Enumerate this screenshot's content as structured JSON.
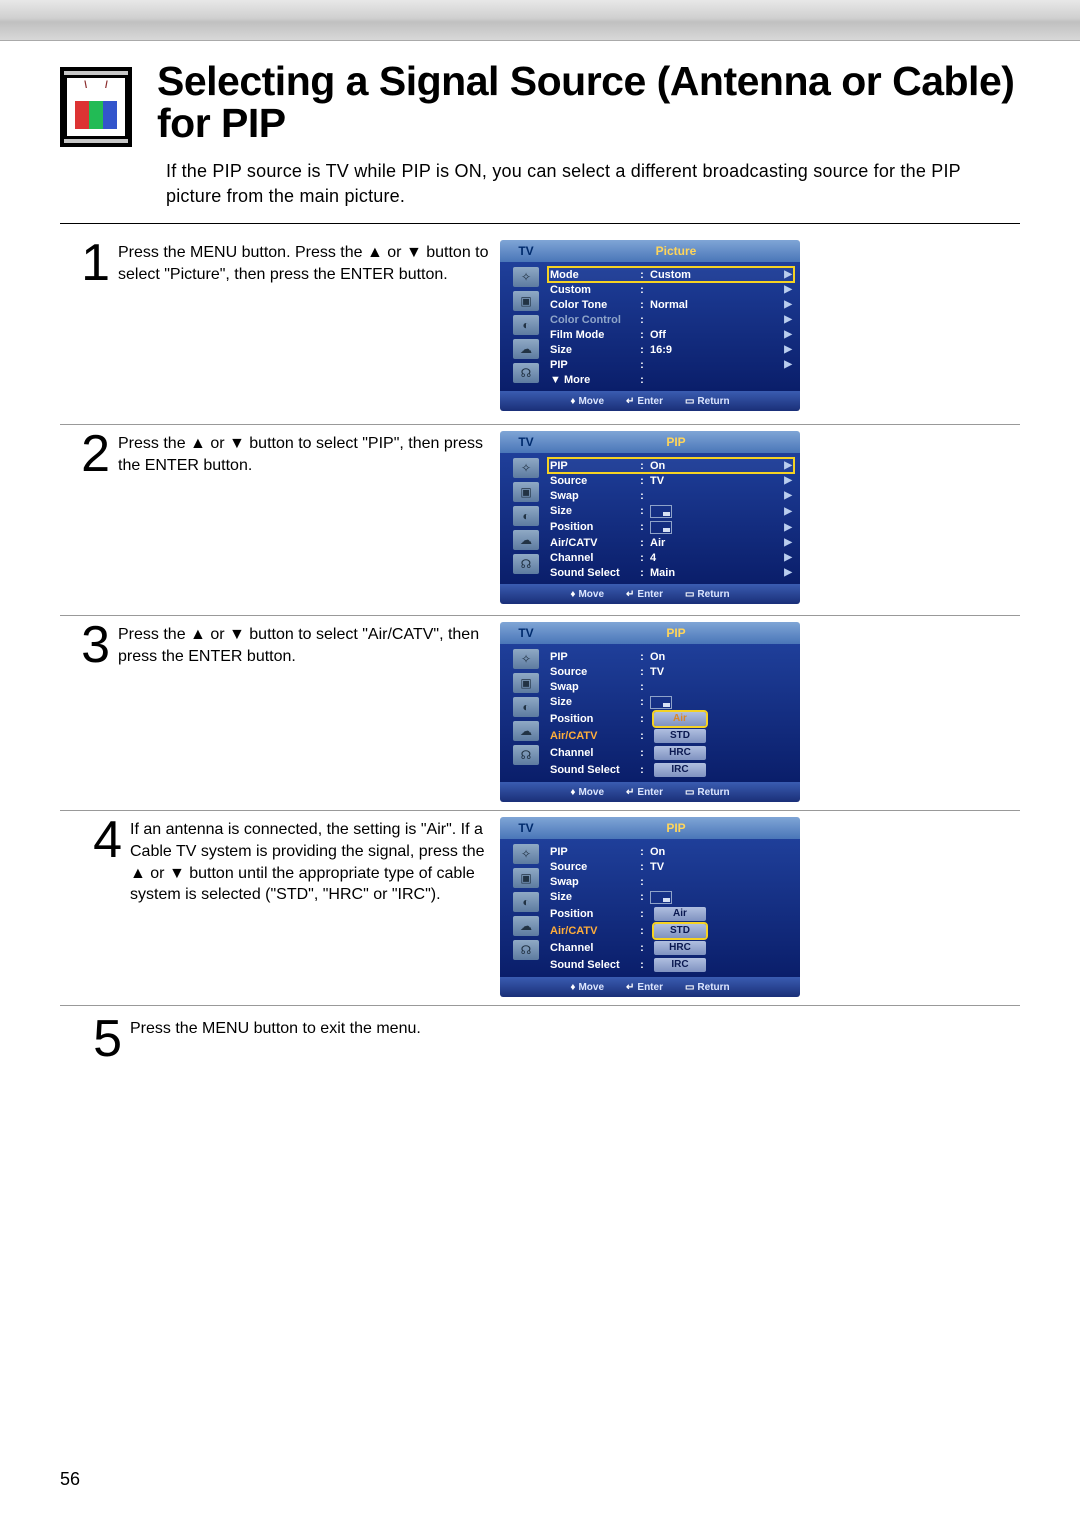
{
  "page_number": "56",
  "title": "Selecting a Signal Source (Antenna or Cable) for PIP",
  "subtitle": "If the PIP source is TV while PIP is ON, you can select a different broadcasting source for the PIP picture from the main picture.",
  "arrows": {
    "up": "▲",
    "down": "▼",
    "right": "▶",
    "updown": "♦"
  },
  "osd_common": {
    "tv_label": "TV",
    "foot_move": "Move",
    "foot_enter": "Enter",
    "foot_return": "Return",
    "sidebar_icons": [
      "✧",
      "▣",
      "◐",
      "☁",
      "☊"
    ]
  },
  "steps": [
    {
      "num": "1",
      "text": "Press the MENU button. Press the ▲ or ▼ button to select \"Picture\", then press the ENTER button.",
      "osd": {
        "title": "Picture",
        "lines": [
          {
            "label": "Mode",
            "value": "Custom",
            "highlight": true,
            "arrow": true
          },
          {
            "label": "Custom",
            "value": "",
            "arrow": true
          },
          {
            "label": "Color Tone",
            "value": "Normal",
            "arrow": true
          },
          {
            "label": "Color Control",
            "value": "",
            "dim": true,
            "arrow": true
          },
          {
            "label": "Film Mode",
            "value": "Off",
            "arrow": true
          },
          {
            "label": "Size",
            "value": "16:9",
            "arrow": true
          },
          {
            "label": "PIP",
            "value": "",
            "arrow": true
          },
          {
            "label": "▼ More",
            "value": ""
          }
        ]
      }
    },
    {
      "num": "2",
      "text": "Press the ▲ or ▼ button to select \"PIP\", then press the ENTER button.",
      "osd": {
        "title": "PIP",
        "lines": [
          {
            "label": "PIP",
            "value": "On",
            "highlight": true,
            "arrow": true
          },
          {
            "label": "Source",
            "value": "TV",
            "arrow": true
          },
          {
            "label": "Swap",
            "value": "",
            "arrow": true
          },
          {
            "label": "Size",
            "value_box": true,
            "arrow": true
          },
          {
            "label": "Position",
            "value_box": true,
            "arrow": true
          },
          {
            "label": "Air/CATV",
            "value": "Air",
            "arrow": true
          },
          {
            "label": "Channel",
            "value": "4",
            "arrow": true
          },
          {
            "label": "Sound Select",
            "value": "Main",
            "arrow": true
          }
        ]
      }
    },
    {
      "num": "3",
      "text": "Press the ▲ or ▼ button to select \"Air/CATV\", then press the ENTER button.",
      "osd": {
        "title": "PIP",
        "lines": [
          {
            "label": "PIP",
            "value": "On"
          },
          {
            "label": "Source",
            "value": "TV"
          },
          {
            "label": "Swap",
            "value": ""
          },
          {
            "label": "Size",
            "value_box": true
          },
          {
            "label": "Position",
            "pills": [
              "Air"
            ],
            "pill_selected": 0,
            "pill_text_orange": true
          },
          {
            "label": "Air/CATV",
            "pills": [
              "STD"
            ],
            "orange": true
          },
          {
            "label": "Channel",
            "pills": [
              "HRC"
            ]
          },
          {
            "label": "Sound Select",
            "pills": [
              "IRC"
            ]
          }
        ]
      }
    },
    {
      "num": "4",
      "text": "If an antenna is connected, the setting is \"Air\". If a Cable TV system is providing the signal, press the ▲ or ▼ button until the appropriate type of cable system is selected (\"STD\", \"HRC\" or \"IRC\").",
      "osd": {
        "title": "PIP",
        "lines": [
          {
            "label": "PIP",
            "value": "On"
          },
          {
            "label": "Source",
            "value": "TV"
          },
          {
            "label": "Swap",
            "value": ""
          },
          {
            "label": "Size",
            "value_box": true
          },
          {
            "label": "Position",
            "pills": [
              "Air"
            ]
          },
          {
            "label": "Air/CATV",
            "pills": [
              "STD"
            ],
            "pill_selected": 0,
            "orange": true
          },
          {
            "label": "Channel",
            "pills": [
              "HRC"
            ]
          },
          {
            "label": "Sound Select",
            "pills": [
              "IRC"
            ]
          }
        ]
      }
    },
    {
      "num": "5",
      "text": "Press the MENU button to exit the menu."
    }
  ]
}
